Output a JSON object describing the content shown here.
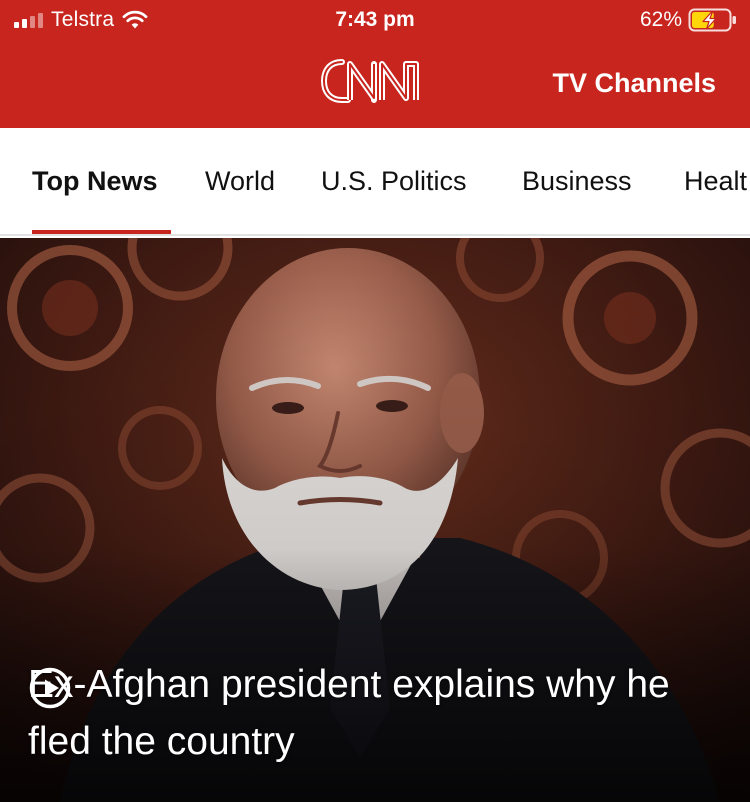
{
  "status_bar": {
    "carrier": "Telstra",
    "time": "7:43 pm",
    "battery_percent": "62%",
    "battery_level": 0.62,
    "signal_bars_active": 2,
    "signal_bars_total": 4
  },
  "header": {
    "logo_text": "CNN",
    "tv_channels_label": "TV Channels",
    "brand_color": "#c7251e"
  },
  "tabs": [
    {
      "label": "Top News",
      "active": true
    },
    {
      "label": "World",
      "active": false
    },
    {
      "label": "U.S. Politics",
      "active": false
    },
    {
      "label": "Business",
      "active": false
    },
    {
      "label": "Healt",
      "active": false
    }
  ],
  "hero": {
    "media_type": "video",
    "play_icon": "play-circle-icon",
    "headline": "Ex-Afghan president explains why he fled the country"
  }
}
